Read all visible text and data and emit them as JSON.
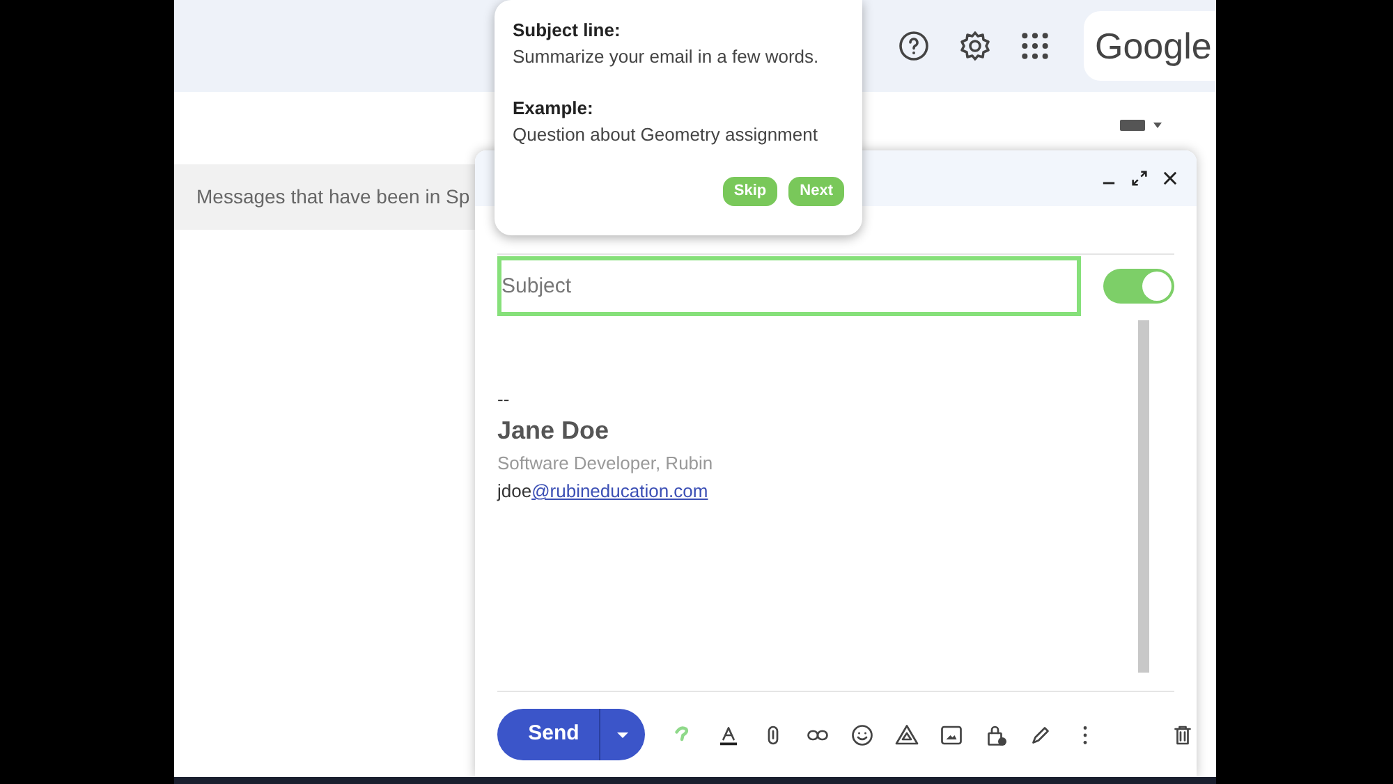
{
  "header": {
    "logo": "Google"
  },
  "list": {
    "banner": "Messages that have been in Sp"
  },
  "compose": {
    "subject": {
      "placeholder": "Subject"
    },
    "toggle": {
      "on": true
    },
    "signature": {
      "separator": "--",
      "name": "Jane Doe",
      "title": "Software Developer, Rubin",
      "email_user": "jdoe",
      "email_link": "@rubineducation.com"
    },
    "send": "Send"
  },
  "tooltip": {
    "heading": "Subject line:",
    "text": "Summarize your email in a few words.",
    "example_heading": "Example:",
    "example": "Question about Geometry assignment",
    "buttons": [
      "Skip",
      "Next"
    ]
  }
}
